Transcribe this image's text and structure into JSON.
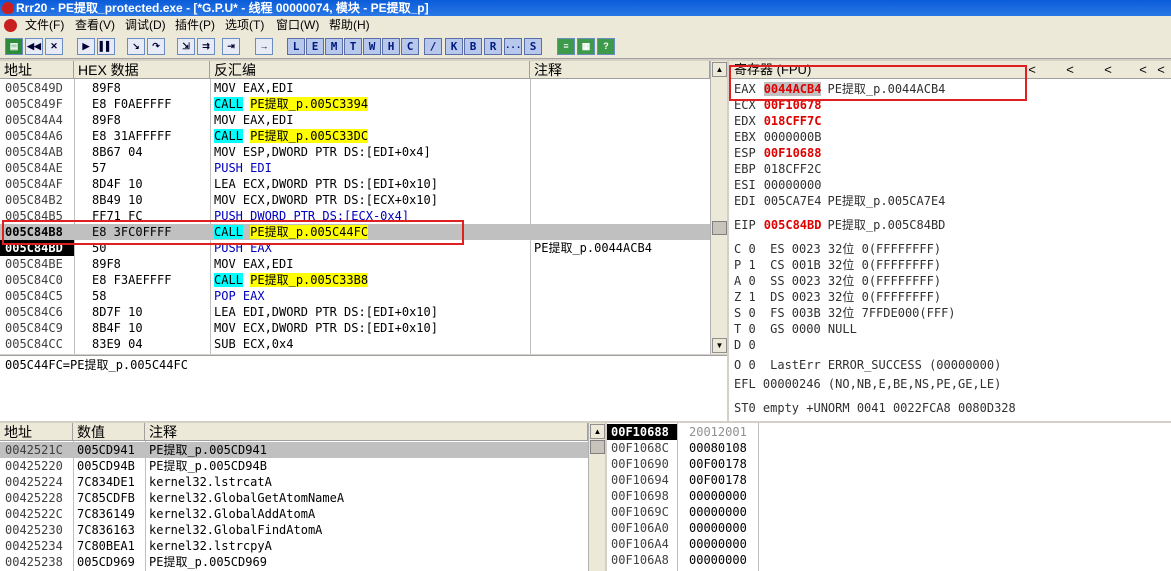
{
  "window": {
    "title": "Rrr20 - PE提取_protected.exe - [*G.P.U* - 线程 00000074, 模块 - PE提取_p]"
  },
  "menu": [
    {
      "label": "文件(F)"
    },
    {
      "label": "查看(V)"
    },
    {
      "label": "调试(D)"
    },
    {
      "label": "插件(P)"
    },
    {
      "label": "选项(T)"
    },
    {
      "label": "窗口(W)"
    },
    {
      "label": "帮助(H)"
    }
  ],
  "toolbar": {
    "letters": [
      "L",
      "E",
      "M",
      "T",
      "W",
      "H",
      "C",
      "/",
      "K",
      "B",
      "R",
      "...",
      "S"
    ]
  },
  "disasm": {
    "headers": {
      "addr": "地址",
      "hex": "HEX 数据",
      "asm": "反汇编",
      "comment": "注释"
    },
    "rows": [
      {
        "addr": "005C849D",
        "hex": "89F8",
        "asm": "MOV EAX,EDI",
        "comment": ""
      },
      {
        "addr": "005C849F",
        "hex": "E8 F0AEFFFF",
        "mn": "CALL",
        "tgt": "PE提取_p.005C3394",
        "comment": ""
      },
      {
        "addr": "005C84A4",
        "hex": "89F8",
        "asm": "MOV EAX,EDI",
        "comment": ""
      },
      {
        "addr": "005C84A6",
        "hex": "E8 31AFFFFF",
        "mn": "CALL",
        "tgt": "PE提取_p.005C33DC",
        "comment": ""
      },
      {
        "addr": "005C84AB",
        "hex": "8B67 04",
        "asm": "MOV ESP,DWORD PTR DS:[EDI+0x4]",
        "comment": ""
      },
      {
        "addr": "005C84AE",
        "hex": "57",
        "asm": "PUSH EDI",
        "comment": "",
        "blue": true
      },
      {
        "addr": "005C84AF",
        "hex": "8D4F 10",
        "asm": "LEA ECX,DWORD PTR DS:[EDI+0x10]",
        "comment": ""
      },
      {
        "addr": "005C84B2",
        "hex": "8B49 10",
        "asm": "MOV ECX,DWORD PTR DS:[ECX+0x10]",
        "comment": ""
      },
      {
        "addr": "005C84B5",
        "hex": "FF71 FC",
        "asm": "PUSH DWORD PTR DS:[ECX-0x4]",
        "comment": "",
        "blue": true
      },
      {
        "addr": "005C84B8",
        "hex": "E8 3FC0FFFF",
        "mn": "CALL",
        "tgt": "PE提取_p.005C44FC",
        "comment": "",
        "selected": true
      },
      {
        "addr": "005C84BD",
        "hex": "50",
        "asm": "PUSH EAX",
        "comment": "PE提取_p.0044ACB4",
        "blue": true,
        "eip": true
      },
      {
        "addr": "005C84BE",
        "hex": "89F8",
        "asm": "MOV EAX,EDI",
        "comment": ""
      },
      {
        "addr": "005C84C0",
        "hex": "E8 F3AEFFFF",
        "mn": "CALL",
        "tgt": "PE提取_p.005C33B8",
        "comment": ""
      },
      {
        "addr": "005C84C5",
        "hex": "58",
        "asm": "POP EAX",
        "comment": "",
        "blue": true
      },
      {
        "addr": "005C84C6",
        "hex": "8D7F 10",
        "asm": "LEA EDI,DWORD PTR DS:[EDI+0x10]",
        "comment": ""
      },
      {
        "addr": "005C84C9",
        "hex": "8B4F 10",
        "asm": "MOV ECX,DWORD PTR DS:[EDI+0x10]",
        "comment": ""
      },
      {
        "addr": "005C84CC",
        "hex": "83E9 04",
        "asm": "SUB ECX,0x4",
        "comment": ""
      }
    ],
    "info_line": "005C44FC=PE提取_p.005C44FC"
  },
  "registers": {
    "title": "寄存器 (FPU)",
    "nav": [
      "<",
      "<",
      "<",
      "<",
      "<"
    ],
    "lines": [
      {
        "name": "EAX",
        "val": "0044ACB4",
        "note": "PE提取_p.0044ACB4",
        "hl": true
      },
      {
        "name": "ECX",
        "val": "00F10678",
        "note": "",
        "red": true
      },
      {
        "name": "EDX",
        "val": "018CFF7C",
        "note": "",
        "red": true
      },
      {
        "name": "EBX",
        "val": "0000000B",
        "note": ""
      },
      {
        "name": "ESP",
        "val": "00F10688",
        "note": "",
        "red": true
      },
      {
        "name": "EBP",
        "val": "018CFF2C",
        "note": ""
      },
      {
        "name": "ESI",
        "val": "00000000",
        "note": ""
      },
      {
        "name": "EDI",
        "val": "005CA7E4",
        "note": "PE提取_p.005CA7E4"
      },
      {
        "name": "EIP",
        "val": "005C84BD",
        "note": "PE提取_p.005C84BD",
        "red": true
      }
    ],
    "flags": [
      "C 0  ES 0023 32位 0(FFFFFFFF)",
      "P 1  CS 001B 32位 0(FFFFFFFF)",
      "A 0  SS 0023 32位 0(FFFFFFFF)",
      "Z 1  DS 0023 32位 0(FFFFFFFF)",
      "S 0  FS 003B 32位 7FFDE000(FFF)",
      "T 0  GS 0000 NULL",
      "D 0",
      "O 0  LastErr ERROR_SUCCESS (00000000)"
    ],
    "efl": "EFL 00000246 (NO,NB,E,BE,NS,PE,GE,LE)",
    "st0": "ST0 empty +UNORM 0041 0022FCA8 0080D328"
  },
  "dump": {
    "headers": {
      "addr": "地址",
      "val": "数值",
      "comment": "注释"
    },
    "rows": [
      {
        "addr": "0042521C",
        "val": "005CD941",
        "comment": "PE提取_p.005CD941"
      },
      {
        "addr": "00425220",
        "val": "005CD94B",
        "comment": "PE提取_p.005CD94B"
      },
      {
        "addr": "00425224",
        "val": "7C834DE1",
        "comment": "kernel32.lstrcatA"
      },
      {
        "addr": "00425228",
        "val": "7C85CDFB",
        "comment": "kernel32.GlobalGetAtomNameA"
      },
      {
        "addr": "0042522C",
        "val": "7C836149",
        "comment": "kernel32.GlobalAddAtomA"
      },
      {
        "addr": "00425230",
        "val": "7C836163",
        "comment": "kernel32.GlobalFindAtomA"
      },
      {
        "addr": "00425234",
        "val": "7C80BEA1",
        "comment": "kernel32.lstrcpyA"
      },
      {
        "addr": "00425238",
        "val": "005CD969",
        "comment": "PE提取_p.005CD969"
      }
    ]
  },
  "stack": {
    "rows": [
      {
        "addr": "00F10688",
        "val": "20012001",
        "top": true
      },
      {
        "addr": "00F1068C",
        "val": "00080108"
      },
      {
        "addr": "00F10690",
        "val": "00F00178"
      },
      {
        "addr": "00F10694",
        "val": "00F00178"
      },
      {
        "addr": "00F10698",
        "val": "00000000"
      },
      {
        "addr": "00F1069C",
        "val": "00000000"
      },
      {
        "addr": "00F106A0",
        "val": "00000000"
      },
      {
        "addr": "00F106A4",
        "val": "00000000"
      },
      {
        "addr": "00F106A8",
        "val": "00000000"
      }
    ]
  }
}
